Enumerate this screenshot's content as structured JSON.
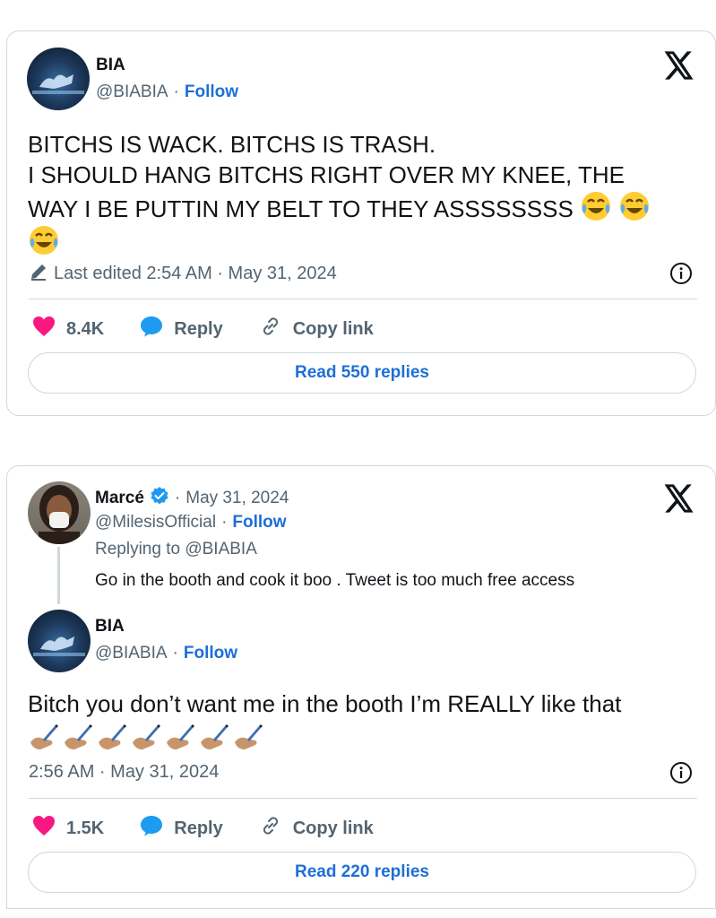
{
  "tweet1": {
    "author_name": "BIA",
    "handle": "@BIABIA",
    "separator": "·",
    "follow_label": "Follow",
    "text_line1": "BITCHS IS WACK. BITCHS IS TRASH.",
    "text_line2": "I SHOULD HANG BITCHS RIGHT OVER MY KNEE, THE",
    "text_line3": "WAY I BE PUTTIN MY BELT TO THEY ASSSSSSSS",
    "edited_label": "Last edited 2:54 AM · May 31, 2024",
    "likes": "8.4K",
    "reply_label": "Reply",
    "copy_link_label": "Copy link",
    "read_replies_label": "Read 550 replies"
  },
  "tweet2": {
    "parent": {
      "author_name": "Marcé",
      "separator": "·",
      "date": "May 31, 2024",
      "handle": "@MilesisOfficial",
      "follow_label": "Follow",
      "replying_to": "Replying to @BIABIA",
      "text": "Go in the booth and cook it boo . Tweet is too much free access"
    },
    "reply": {
      "author_name": "BIA",
      "handle": "@BIABIA",
      "separator": "·",
      "follow_label": "Follow",
      "text": "Bitch you don’t want me in the booth I’m REALLY like that",
      "timestamp": "2:56 AM · May 31, 2024",
      "likes": "1.5K",
      "reply_label": "Reply",
      "copy_link_label": "Copy link",
      "read_replies_label": "Read 220 replies"
    }
  },
  "icons": {
    "logo": "x-logo-icon",
    "like": "heart-icon",
    "reply": "speech-bubble-icon",
    "copy": "link-icon",
    "info": "info-icon",
    "edit": "pencil-icon",
    "verified": "verified-badge-icon",
    "emoji_laugh": "face-with-tears-of-joy-icon",
    "emoji_write": "writing-hand-icon"
  },
  "colors": {
    "link_blue": "#1d6fd6",
    "heart_pink": "#f91880",
    "reply_blue": "#1d9bf0",
    "border": "#cfd9de",
    "muted": "#536471"
  }
}
